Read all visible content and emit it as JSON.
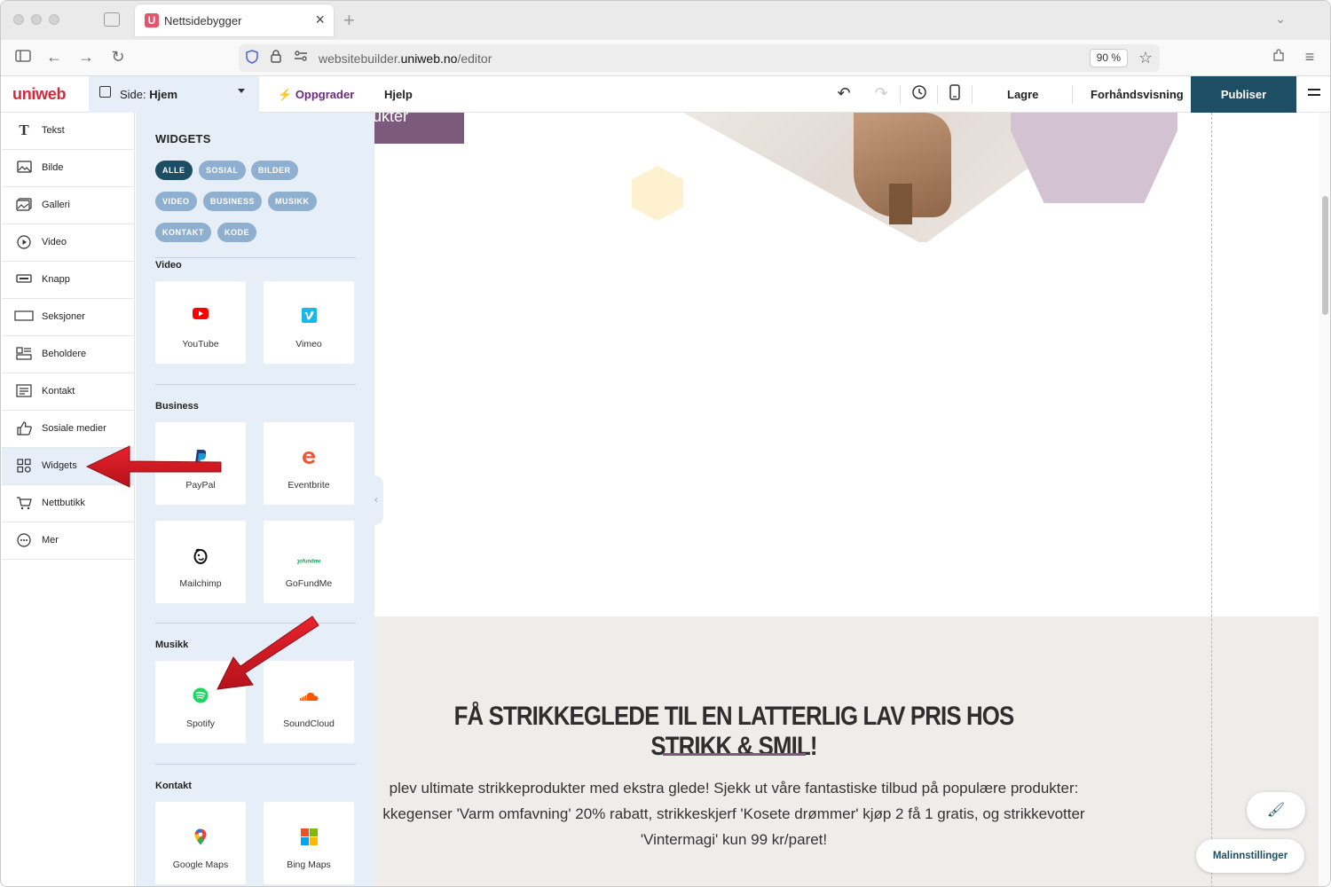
{
  "browser": {
    "tab_title": "Nettsidebygger",
    "tab_favicon": "U",
    "url_prefix": "websitebuilder.",
    "url_domain": "uniweb.no",
    "url_path": "/editor",
    "zoom": "90 %"
  },
  "toolbar": {
    "logo": "uniweb",
    "page_label": "Side: ",
    "page_value": "Hjem",
    "upgrade_label": "Oppgrader",
    "help_label": "Hjelp",
    "save_label": "Lagre",
    "preview_label": "Forhåndsvisning",
    "publish_label": "Publiser"
  },
  "sidebar": {
    "items": [
      {
        "label": "Tekst",
        "icon": "text-icon"
      },
      {
        "label": "Bilde",
        "icon": "image-icon"
      },
      {
        "label": "Galleri",
        "icon": "gallery-icon"
      },
      {
        "label": "Video",
        "icon": "video-icon"
      },
      {
        "label": "Knapp",
        "icon": "button-icon"
      },
      {
        "label": "Seksjoner",
        "icon": "section-icon"
      },
      {
        "label": "Beholdere",
        "icon": "container-icon"
      },
      {
        "label": "Kontakt",
        "icon": "contact-form-icon"
      },
      {
        "label": "Sosiale medier",
        "icon": "thumbs-up-icon"
      },
      {
        "label": "Widgets",
        "icon": "widgets-icon"
      },
      {
        "label": "Nettbutikk",
        "icon": "cart-icon"
      },
      {
        "label": "Mer",
        "icon": "more-icon"
      }
    ],
    "active": "Widgets"
  },
  "widgets_panel": {
    "title": "WIDGETS",
    "filters": [
      "ALLE",
      "SOSIAL",
      "BILDER",
      "VIDEO",
      "BUSINESS",
      "MUSIKK",
      "KONTAKT",
      "KODE"
    ],
    "active_filter": "ALLE",
    "sections": [
      {
        "title": "Video",
        "items": [
          "YouTube",
          "Vimeo"
        ]
      },
      {
        "title": "Business",
        "items": [
          "PayPal",
          "Eventbrite",
          "Mailchimp",
          "GoFundMe"
        ]
      },
      {
        "title": "Musikk",
        "items": [
          "Spotify",
          "SoundCloud"
        ]
      },
      {
        "title": "Kontakt",
        "items": [
          "Google Maps",
          "Bing Maps"
        ]
      }
    ]
  },
  "canvas": {
    "button_fragment": "ukter",
    "headline": "FÅ STRIKKEGLEDE TIL EN LATTERLIG LAV PRIS HOS STRIKK & SMIL!",
    "body_line1": "plev ultimate strikkeprodukter med ekstra glede! Sjekk ut våre fantastiske tilbud på populære produkter:",
    "body_line2": "kkegenser 'Varm omfavning' 20% rabatt, strikkeskjerf 'Kosete drømmer' kjøp 2 få 1 gratis, og strikkevotter",
    "body_line3": "'Vintermagi' kun 99 kr/paret!",
    "accent_color": "#7b5a7e"
  },
  "floating": {
    "template_settings_label": "Malinnstillinger"
  }
}
